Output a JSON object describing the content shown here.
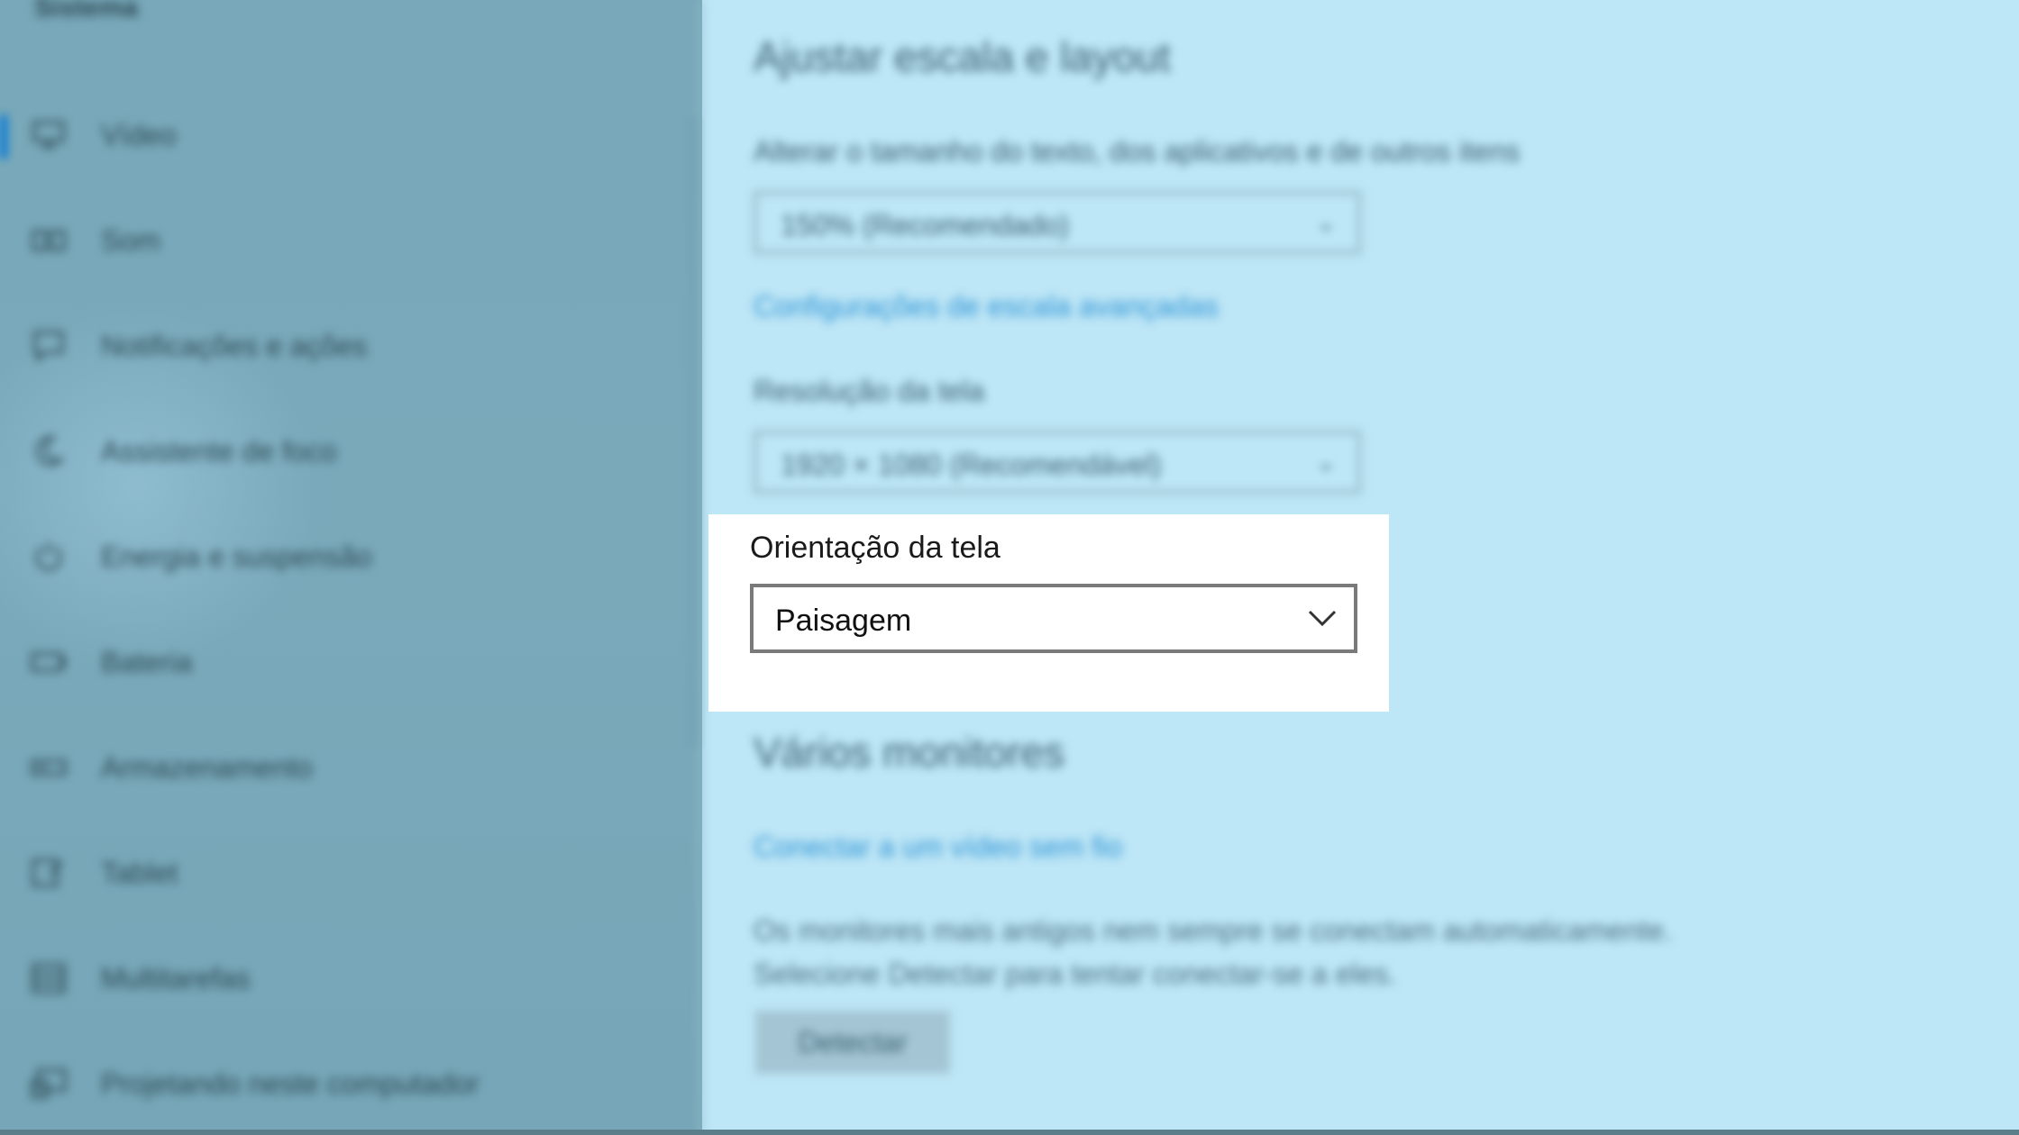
{
  "sidebar": {
    "header": "Sistema",
    "items": [
      {
        "label": "Vídeo",
        "icon": "monitor-icon",
        "selected": true
      },
      {
        "label": "Som",
        "icon": "speaker-icon"
      },
      {
        "label": "Notificações e ações",
        "icon": "notification-icon"
      },
      {
        "label": "Assistente de foco",
        "icon": "moon-icon"
      },
      {
        "label": "Energia e suspensão",
        "icon": "power-icon"
      },
      {
        "label": "Bateria",
        "icon": "battery-icon"
      },
      {
        "label": "Armazenamento",
        "icon": "storage-icon"
      },
      {
        "label": "Tablet",
        "icon": "tablet-icon"
      },
      {
        "label": "Multitarefas",
        "icon": "multitask-icon"
      },
      {
        "label": "Projetando neste computador",
        "icon": "projector-icon"
      }
    ]
  },
  "main": {
    "scale_section_title": "Ajustar escala e layout",
    "scale_caption": "Alterar o tamanho do texto, dos aplicativos e de outros itens",
    "scale_value": "150% (Recomendado)",
    "advanced_scale_link": "Configurações de escala avançadas",
    "resolution_caption": "Resolução da tela",
    "resolution_value": "1920 × 1080 (Recomendável)",
    "orientation_caption": "Orientação da tela",
    "orientation_value": "Paisagem",
    "monitors_section_title": "Vários monitores",
    "wireless_link": "Conectar a um vídeo sem fio",
    "monitors_note_line1": "Os monitores mais antigos nem sempre se conectam automaticamente.",
    "monitors_note_line2": "Selecione Detectar para tentar conectar-se a eles.",
    "detect_button": "Detectar"
  },
  "colors": {
    "accent": "#0078d7",
    "link": "#2f93d6",
    "content_bg": "#bde6f6",
    "sidebar_bg": "#78a8b9",
    "spotlight_bg": "#ffffff"
  }
}
